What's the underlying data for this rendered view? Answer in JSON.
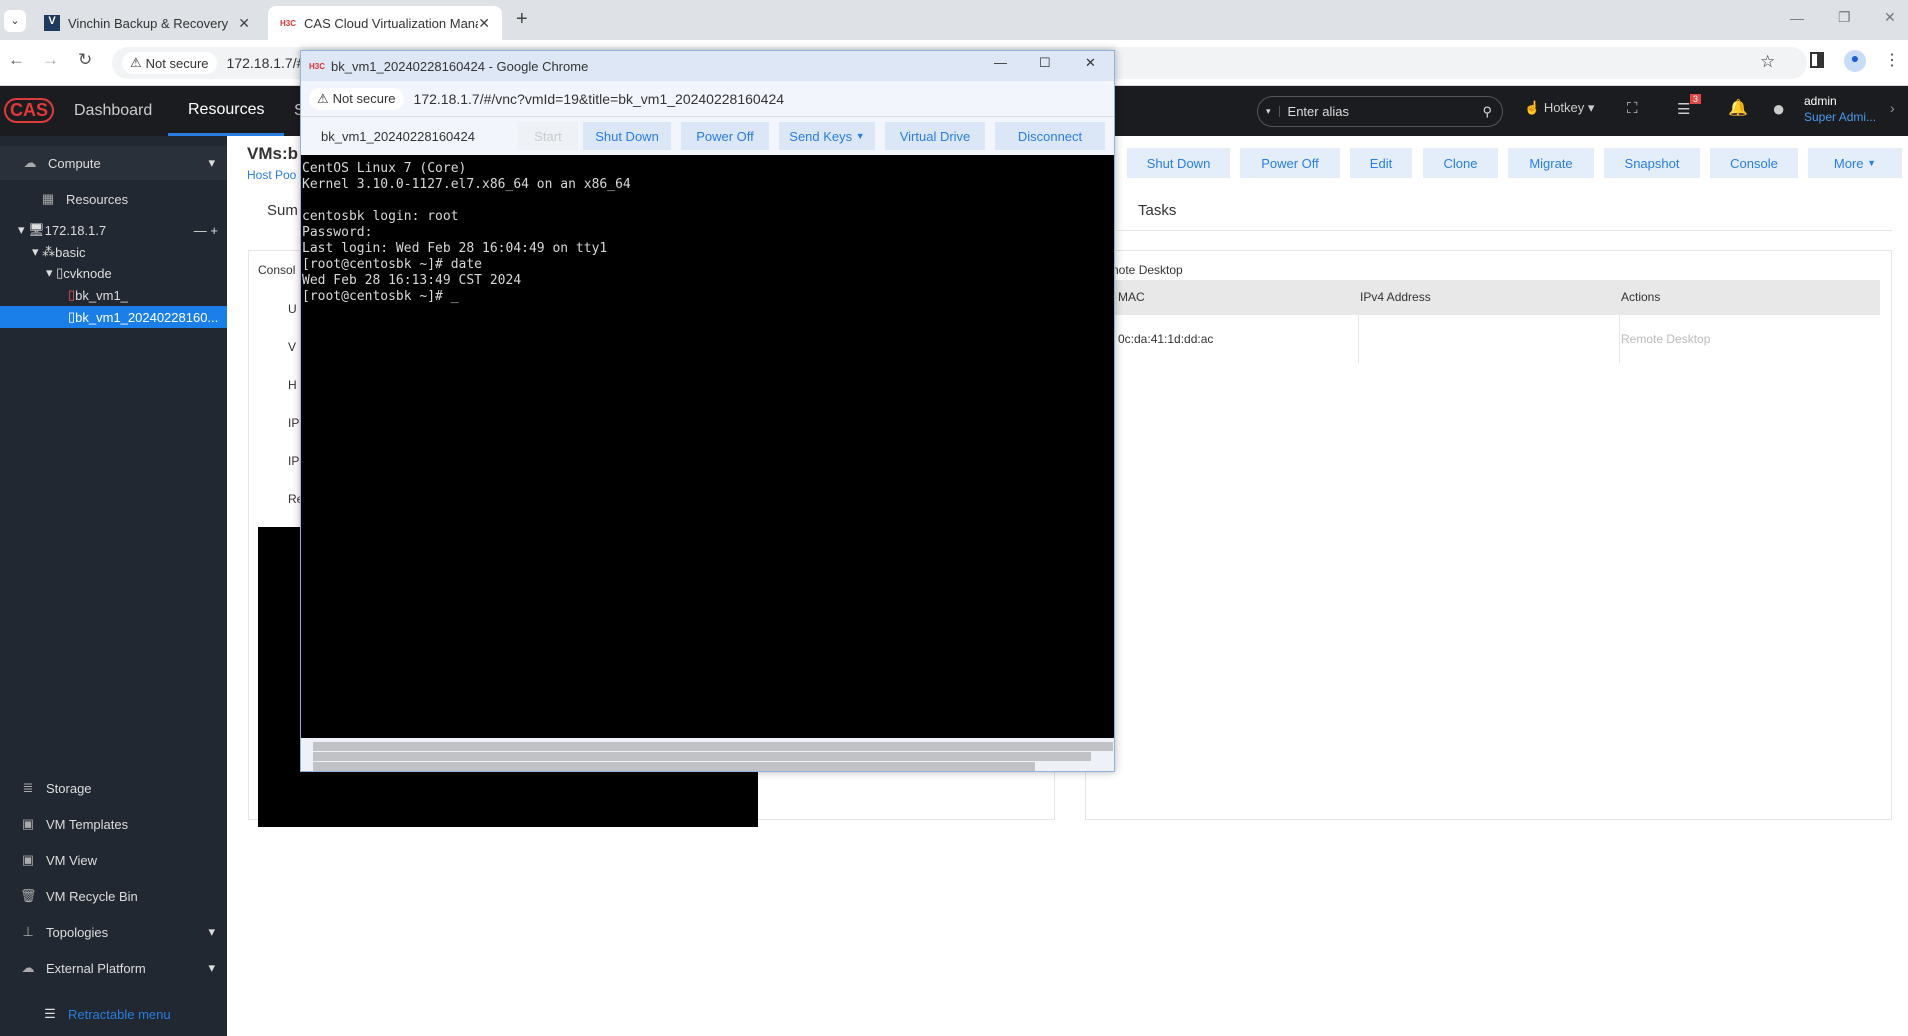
{
  "browser": {
    "tabs": [
      {
        "label": "Vinchin Backup & Recovery",
        "icon": "V"
      },
      {
        "label": "CAS Cloud Virtualization Manag",
        "icon": "H3C",
        "active": true
      }
    ],
    "not_secure": "Not secure",
    "url": "172.18.1.7/#/i"
  },
  "app": {
    "logo": "CAS",
    "nav": [
      {
        "label": "Dashboard"
      },
      {
        "label": "Resources",
        "active": true
      },
      {
        "label": "S"
      }
    ],
    "search_placeholder": "Enter alias",
    "hotkey": "Hotkey",
    "notif_badge": "3",
    "user_name": "admin",
    "user_role": "Super Admi..."
  },
  "sidebar": {
    "compute": "Compute",
    "resources": "Resources",
    "tree": [
      {
        "label": "172.18.1.7"
      },
      {
        "label": "basic"
      },
      {
        "label": "cvknode"
      },
      {
        "label": "bk_vm1_"
      },
      {
        "label": "bk_vm1_20240228160...",
        "selected": true
      }
    ],
    "items": [
      {
        "label": "Storage"
      },
      {
        "label": "VM Templates"
      },
      {
        "label": "VM View"
      },
      {
        "label": "VM Recycle Bin"
      },
      {
        "label": "Topologies"
      },
      {
        "label": "External Platform"
      }
    ],
    "retract": "Retractable menu"
  },
  "main": {
    "title": "VMs:b",
    "breadcrumb": "Host Poo",
    "tab_summary": "Sum",
    "tab_tasks": "Tasks",
    "console_label": "Consol",
    "field_labels": [
      "U",
      "V",
      "H",
      "IP",
      "IP",
      "Re"
    ],
    "actions": [
      "Shut Down",
      "Power Off",
      "Edit",
      "Clone",
      "Migrate",
      "Snapshot",
      "Console",
      "More"
    ],
    "remote_title": "note Desktop",
    "table": {
      "headers": [
        "MAC",
        "IPv4 Address",
        "Actions"
      ],
      "rows": [
        [
          "0c:da:41:1d:dd:ac",
          "",
          "Remote Desktop"
        ]
      ]
    }
  },
  "popup": {
    "title": "bk_vm1_20240228160424 - Google Chrome",
    "not_secure": "Not secure",
    "url": "172.18.1.7/#/vnc?vmId=19&title=bk_vm1_20240228160424",
    "vm_name": "bk_vm1_20240228160424",
    "buttons": [
      "Start",
      "Shut Down",
      "Power Off",
      "Send Keys",
      "Virtual Drive",
      "Disconnect"
    ],
    "terminal": "CentOS Linux 7 (Core)\nKernel 3.10.0-1127.el7.x86_64 on an x86_64\n\ncentosbk login: root\nPassword:\nLast login: Wed Feb 28 16:04:49 on tty1\n[root@centosbk ~]# date\nWed Feb 28 16:13:49 CST 2024\n[root@centosbk ~]# _"
  }
}
